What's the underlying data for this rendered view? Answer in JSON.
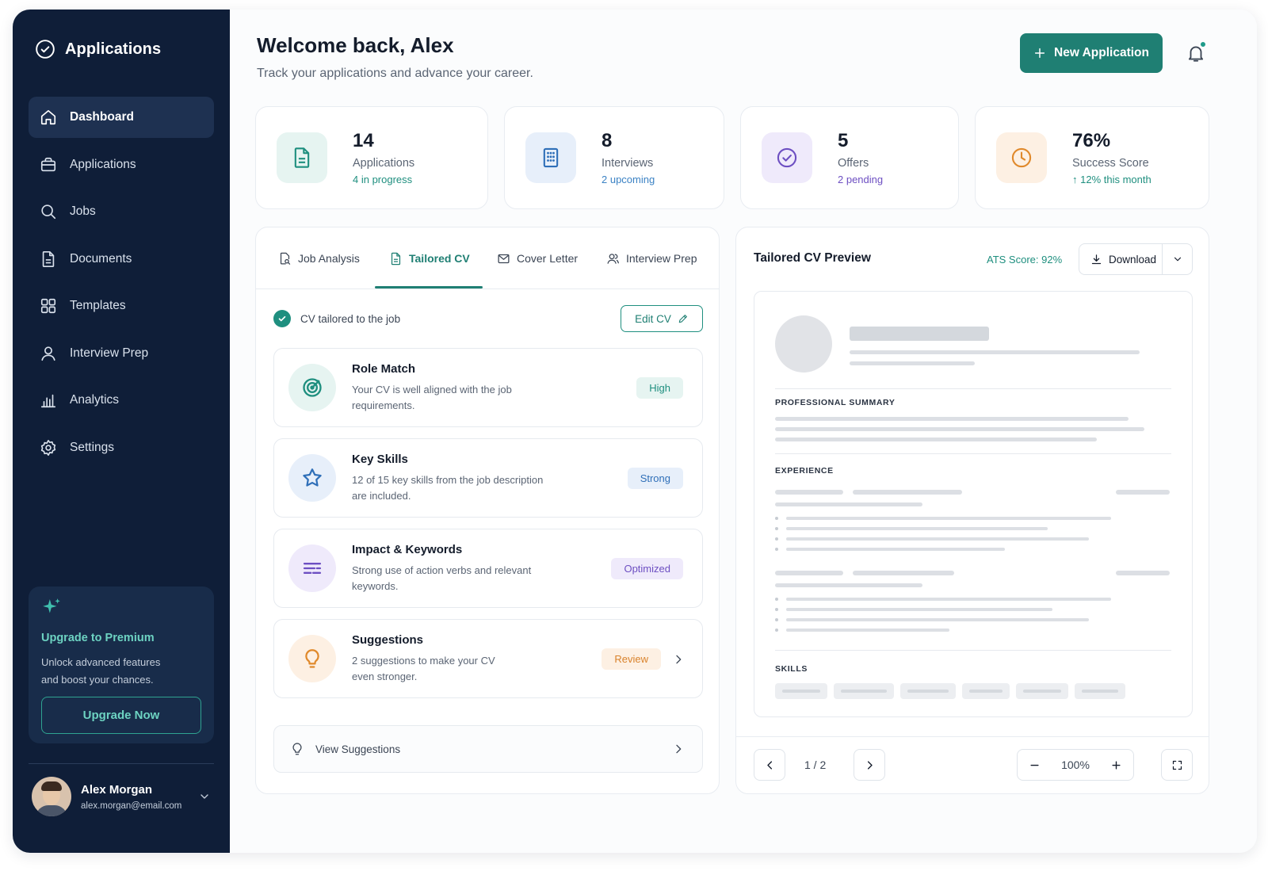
{
  "sidebar": {
    "brand": "Applications",
    "nav": [
      {
        "label": "Dashboard",
        "icon": "home-icon",
        "active": true
      },
      {
        "label": "Applications",
        "icon": "briefcase-icon"
      },
      {
        "label": "Jobs",
        "icon": "search-icon"
      },
      {
        "label": "Documents",
        "icon": "document-icon"
      },
      {
        "label": "Templates",
        "icon": "grid-icon"
      },
      {
        "label": "Interview Prep",
        "icon": "user-icon"
      },
      {
        "label": "Analytics",
        "icon": "bar-chart-icon"
      },
      {
        "label": "Settings",
        "icon": "gear-icon"
      }
    ],
    "premium": {
      "title": "Upgrade to Premium",
      "desc_line1": "Unlock advanced features",
      "desc_line2": "and boost your chances.",
      "button": "Upgrade Now"
    },
    "user": {
      "name": "Alex Morgan",
      "email": "alex.morgan@email.com"
    }
  },
  "header": {
    "title": "Welcome back, Alex",
    "subtitle": "Track your applications and advance your career.",
    "new_button": "New Application"
  },
  "stats": [
    {
      "value": "14",
      "label": "Applications",
      "sub": "4 in progress",
      "sub_color": "#1f8f7f",
      "icon": "document-icon",
      "icon_color": "#1f8f7f",
      "icon_bg": "#e6f4f1"
    },
    {
      "value": "8",
      "label": "Interviews",
      "sub": "2 upcoming",
      "sub_color": "#3b82c4",
      "icon": "building-icon",
      "icon_color": "#2f6fb8",
      "icon_bg": "#e7effa"
    },
    {
      "value": "5",
      "label": "Offers",
      "sub": "2 pending",
      "sub_color": "#6d4fc2",
      "icon": "check-circle-icon",
      "icon_color": "#6d4fc2",
      "icon_bg": "#efeafb"
    },
    {
      "value": "76%",
      "label": "Success Score",
      "sub": "12% this month",
      "sub_color": "#1f8f7f",
      "icon": "clock-icon",
      "icon_color": "#e0892b",
      "icon_bg": "#fdf0e3"
    }
  ],
  "tabs": [
    {
      "label": "Job Analysis",
      "icon": "file-search-icon"
    },
    {
      "label": "Tailored CV",
      "icon": "document-icon",
      "active": true
    },
    {
      "label": "Cover Letter",
      "icon": "mail-icon"
    },
    {
      "label": "Interview Prep",
      "icon": "users-icon"
    }
  ],
  "tailored": {
    "status": "CV tailored to the job",
    "edit_button": "Edit CV"
  },
  "items": [
    {
      "title": "Role Match",
      "desc1": "Your CV is well aligned with the job",
      "desc2": "requirements.",
      "badge": "High",
      "badge_color": "#1f8f7f",
      "badge_bg": "#e6f4f1",
      "icon": "target-icon",
      "icon_color": "#1f8f7f",
      "icon_bg": "#e6f4f1"
    },
    {
      "title": "Key Skills",
      "desc1": "12 of 15 key skills from the job description",
      "desc2": "are included.",
      "badge": "Strong",
      "badge_color": "#2f6fb8",
      "badge_bg": "#e7effa",
      "icon": "star-icon",
      "icon_color": "#2f6fb8",
      "icon_bg": "#e7effa"
    },
    {
      "title": "Impact & Keywords",
      "desc1": "Strong use of action verbs and relevant",
      "desc2": "keywords.",
      "badge": "Optimized",
      "badge_color": "#6d4fc2",
      "badge_bg": "#efeafb",
      "icon": "lines-icon",
      "icon_color": "#6d4fc2",
      "icon_bg": "#efeafb"
    },
    {
      "title": "Suggestions",
      "desc1": "2 suggestions to make your CV",
      "desc2": "even stronger.",
      "badge": "Review",
      "badge_color": "#d9822b",
      "badge_bg": "#fdf0e3",
      "icon": "lightbulb-icon",
      "icon_color": "#e0892b",
      "icon_bg": "#fdf0e3"
    }
  ],
  "view_suggestions": "View Suggestions",
  "preview": {
    "title": "Tailored CV Preview",
    "ats": "ATS Score: 92%",
    "download": "Download",
    "sections": {
      "summary": "PROFESSIONAL SUMMARY",
      "experience": "EXPERIENCE",
      "skills": "SKILLS"
    },
    "page": "1 / 2",
    "zoom": "100%"
  }
}
